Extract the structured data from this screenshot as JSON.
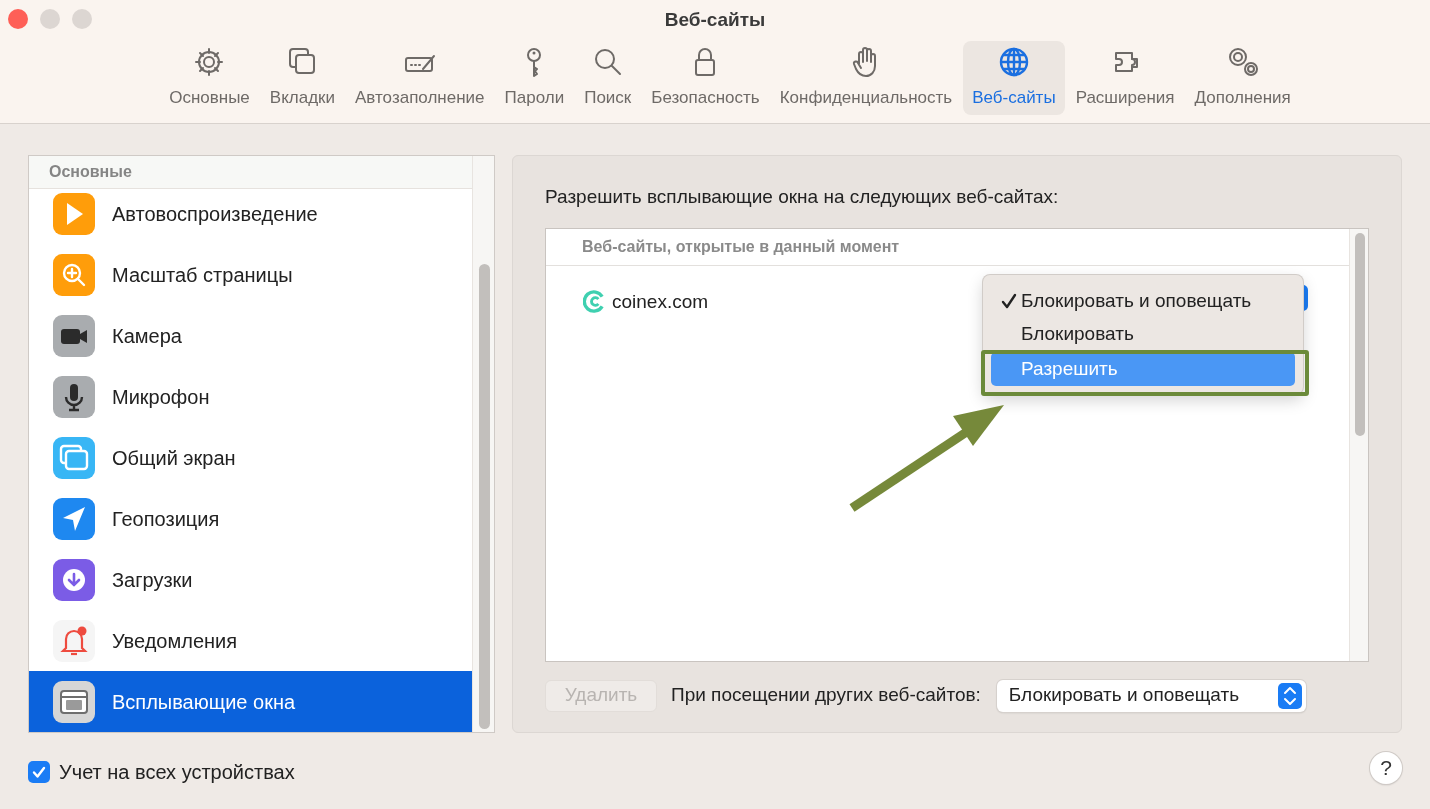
{
  "window": {
    "title": "Веб-сайты"
  },
  "toolbar": [
    {
      "label": "Основные",
      "selected": false
    },
    {
      "label": "Вкладки",
      "selected": false
    },
    {
      "label": "Автозаполнение",
      "selected": false
    },
    {
      "label": "Пароли",
      "selected": false
    },
    {
      "label": "Поиск",
      "selected": false
    },
    {
      "label": "Безопасность",
      "selected": false
    },
    {
      "label": "Конфиденциальность",
      "selected": false
    },
    {
      "label": "Веб-сайты",
      "selected": true
    },
    {
      "label": "Расширения",
      "selected": false
    },
    {
      "label": "Дополнения",
      "selected": false
    }
  ],
  "sidebar": {
    "section": "Основные",
    "items": [
      {
        "label": "Автовоспроизведение",
        "selected": false
      },
      {
        "label": "Масштаб страницы",
        "selected": false
      },
      {
        "label": "Камера",
        "selected": false
      },
      {
        "label": "Микрофон",
        "selected": false
      },
      {
        "label": "Общий экран",
        "selected": false
      },
      {
        "label": "Геопозиция",
        "selected": false
      },
      {
        "label": "Загрузки",
        "selected": false
      },
      {
        "label": "Уведомления",
        "selected": false
      },
      {
        "label": "Всплывающие окна",
        "selected": true
      }
    ]
  },
  "panel": {
    "heading": "Разрешить всплывающие окна на следующих веб-сайтах:",
    "table": {
      "header": "Веб-сайты, открытые в данный момент",
      "rows": [
        {
          "site": "coinex.com"
        }
      ]
    },
    "remove_button": {
      "label": "Удалить",
      "disabled": true
    },
    "other_sites": {
      "label": "При посещении других веб-сайтов:",
      "value": "Блокировать и оповещать"
    }
  },
  "popup_menu": {
    "items": [
      {
        "label": "Блокировать и оповещать",
        "checked": true,
        "selected": false
      },
      {
        "label": "Блокировать",
        "checked": false,
        "selected": false
      },
      {
        "label": "Разрешить",
        "checked": false,
        "selected": true
      }
    ]
  },
  "sync_checkbox": {
    "label": "Учет на всех устройствах",
    "checked": true
  },
  "help_button": "?"
}
